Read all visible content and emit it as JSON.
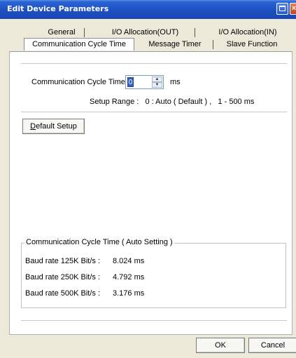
{
  "window": {
    "title": "Edit Device Parameters"
  },
  "tabs": {
    "row1": [
      "General",
      "I/O Allocation(OUT)",
      "I/O Allocation(IN)"
    ],
    "row2": [
      "Communication Cycle Time",
      "Message Timer",
      "Slave Function"
    ],
    "active": "Communication Cycle Time"
  },
  "cycle": {
    "label": "Communication Cycle Time :",
    "value": "0",
    "unit": "ms",
    "range": "Setup Range :   0 : Auto ( Default ) ,   1 - 500 ms"
  },
  "default_button": {
    "label": "Default Setup",
    "mnemonic": "D",
    "rest": "efault Setup"
  },
  "auto_group": {
    "title": "Communication Cycle Time ( Auto Setting )",
    "rows": [
      {
        "label": "Baud rate 125K Bit/s :",
        "value": "8.024 ms"
      },
      {
        "label": "Baud rate 250K Bit/s :",
        "value": "4.792 ms"
      },
      {
        "label": "Baud rate 500K Bit/s :",
        "value": "3.176 ms"
      }
    ]
  },
  "buttons": {
    "ok": "OK",
    "cancel": "Cancel"
  },
  "colors": {
    "titlebar": "#1d4fc1",
    "dialog_bg": "#ece9d8",
    "panel_bg": "#ffffff"
  }
}
